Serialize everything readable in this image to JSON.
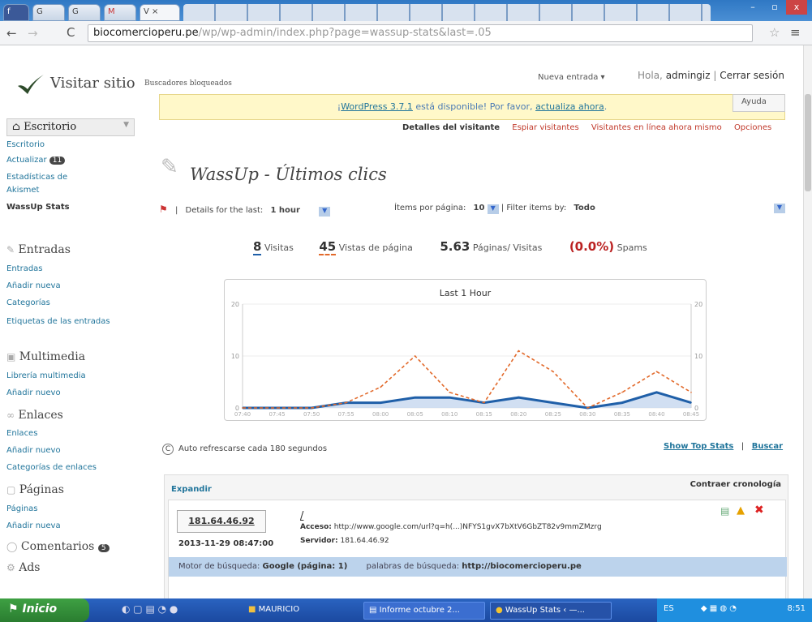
{
  "browser": {
    "tabs": [
      "f",
      "G",
      "G",
      "M",
      "V ×"
    ],
    "url_host": "biocomercioperu.pe",
    "url_path": "/wp/wp-admin/index.php?page=wassup-stats&last=.05",
    "window_controls": [
      "–",
      "▫",
      "x"
    ]
  },
  "adminbar": {
    "site_title": "Visitar sitio",
    "blocked": "Buscadores bloqueados",
    "new_entry": "Nueva entrada",
    "greeting": "Hola,",
    "user": "admingiz",
    "logout": "Cerrar sesión",
    "help": "Ayuda"
  },
  "notice": {
    "prefix": "¡",
    "version_link": "WordPress 3.7.1",
    "middle": " está disponible! Por favor, ",
    "update_link": "actualiza ahora",
    "suffix": "."
  },
  "sidebar": {
    "escritorio": "Escritorio",
    "escritorio_sub": "Escritorio",
    "actualizar": "Actualizar",
    "actualizar_count": "11",
    "akismet": "Estadísticas de Akismet",
    "wassup": "WassUp Stats",
    "entradas": "Entradas",
    "entradas_items": [
      "Entradas",
      "Añadir nueva",
      "Categorías",
      "Etiquetas de las entradas"
    ],
    "multimedia": "Multimedia",
    "multimedia_items": [
      "Librería multimedia",
      "Añadir nuevo"
    ],
    "enlaces": "Enlaces",
    "enlaces_items": [
      "Enlaces",
      "Añadir nuevo",
      "Categorías de enlaces"
    ],
    "paginas": "Páginas",
    "paginas_items": [
      "Páginas",
      "Añadir nueva"
    ],
    "comentarios": "Comentarios",
    "comentarios_count": "5",
    "ads": "Ads"
  },
  "submenu": [
    "Detalles del visitante",
    "Espiar visitantes",
    "Visitantes en línea ahora mismo",
    "Opciones"
  ],
  "wassup": {
    "title": "WassUp - Últimos clics",
    "details_label": "Details for the last:",
    "details_value": "1 hour",
    "items_label": "Ítems por página:",
    "items_value": "10",
    "filter_label": "Filter items by:",
    "filter_value": "Todo",
    "visits_num": "8",
    "visits_label": "Visitas",
    "pageviews_num": "45",
    "pageviews_label": "Vistas de página",
    "ratio_num": "5.63",
    "ratio_label": "Páginas/ Visitas",
    "spam_num": "(0.0%)",
    "spam_label": "Spams",
    "refresh": "Auto refrescarse cada 180 segundos",
    "top_stats": "Show Top Stats",
    "search": "Buscar",
    "expand": "Expandir",
    "collapse": "Contraer cronología"
  },
  "entry": {
    "ip": "181.64.46.92",
    "date": "2013-11-29 08:47:00",
    "path": "/",
    "access_label": "Acceso:",
    "access_value": "http://www.google.com/url?q=h(...)NFYS1gvX7bXtV6GbZT82v9mmZMzrg",
    "server_label": "Servidor:",
    "server_value": "181.64.46.92",
    "engine_label": "Motor de búsqueda:",
    "engine_value": "Google (página: 1)",
    "keywords_label": "palabras de búsqueda:",
    "keywords_value": "http://biocomercioperu.pe"
  },
  "taskbar": {
    "start": "Inicio",
    "items": [
      "MAURICIO",
      "Informe octubre 2...",
      "WassUp Stats ‹ —..."
    ],
    "lang": "ES",
    "clock": "8:51"
  },
  "chart_data": {
    "type": "line",
    "title": "Last 1 Hour",
    "x": [
      "07:40",
      "07:45",
      "07:50",
      "07:55",
      "08:00",
      "08:05",
      "08:10",
      "08:15",
      "08:20",
      "08:25",
      "08:30",
      "08:35",
      "08:40",
      "08:45"
    ],
    "ylim": [
      0,
      20
    ],
    "yticks": [
      0,
      10,
      20
    ],
    "series": [
      {
        "values": [
          0,
          0,
          0,
          1,
          1,
          2,
          2,
          1,
          2,
          1,
          0,
          1,
          3,
          1
        ],
        "color": "#1f5fa8"
      },
      {
        "values": [
          0,
          0,
          0,
          1,
          4,
          10,
          3,
          1,
          11,
          7,
          0,
          3,
          7,
          3
        ],
        "color": "#e2692a"
      }
    ]
  }
}
